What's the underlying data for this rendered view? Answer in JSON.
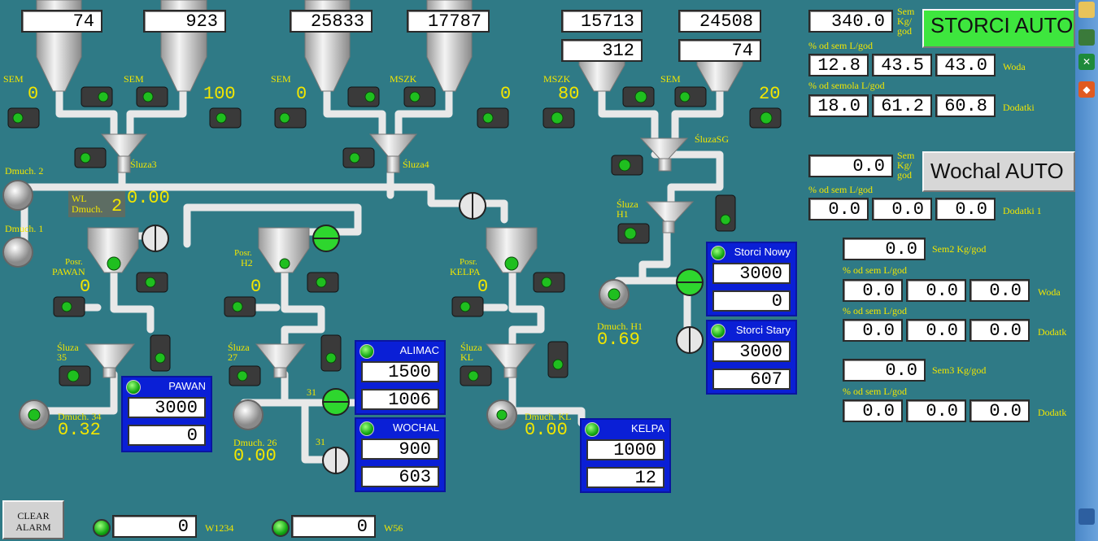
{
  "hoppers_top": {
    "h1": "74",
    "h2": "923",
    "h3": "25833",
    "h4": "17787",
    "h5_top": "15713",
    "h5_sub": "312",
    "h6_top": "24508",
    "h6_sub": "74"
  },
  "motor_labels": {
    "m1_name": "SEM",
    "m1_val": "0",
    "m2_name": "SEM",
    "m2_val": "100",
    "m3_name": "SEM",
    "m3_val": "0",
    "m4_name": "MSZK",
    "m4_val": "0",
    "m5_name": "MSZK",
    "m5_val": "80",
    "m6_name": "SEM",
    "m6_val": "20"
  },
  "sluices": {
    "s3": "Śluza3",
    "s4": "Śluza4",
    "ssg": "ŚluzaSG",
    "sh1_a": "Śluza",
    "sh1_b": "H1",
    "s35_a": "Śluza",
    "s35_b": "35",
    "s27_a": "Śluza",
    "s27_b": "27",
    "skl_a": "Śluza",
    "skl_b": "KL"
  },
  "blowers": {
    "d2": "Dmuch. 2",
    "d1": "Dmuch. 1",
    "wl_a": "WL",
    "wl_b": "Dmuch.",
    "wl_num": "2",
    "wl_val": "0.00",
    "d34": "Dmuch. 34",
    "d34_val": "0.32",
    "d26": "Dmuch. 26",
    "d26_val": "0.00",
    "dkl": "Dmuch. KL",
    "dkl_val": "0.00",
    "dh1": "Dmuch. H1",
    "dh1_val": "0.69"
  },
  "posr": {
    "pawan_a": "Posr.",
    "pawan_b": "PAWAN",
    "pawan_val": "0",
    "h2_a": "Posr.",
    "h2_b": "H2",
    "h2_val": "0",
    "kelpa_a": "Posr.",
    "kelpa_b": "KELPA",
    "kelpa_val": "0"
  },
  "small_labels": {
    "v31a": "31",
    "v31b": "31"
  },
  "panels": {
    "pawan": {
      "title": "PAWAN",
      "v1": "3000",
      "v2": "0"
    },
    "alimac": {
      "title": "ALIMAC",
      "v1": "1500",
      "v2": "1006"
    },
    "wochal": {
      "title": "WOCHAL",
      "v1": "900",
      "v2": "603"
    },
    "kelpa": {
      "title": "KELPA",
      "v1": "1000",
      "v2": "12"
    },
    "storci_nowy": {
      "title": "Storci Nowy",
      "v1": "3000",
      "v2": "0"
    },
    "storci_stary": {
      "title": "Storci Stary",
      "v1": "3000",
      "v2": "607"
    }
  },
  "right_storci": {
    "sem_val": "340.0",
    "sem_unit_a": "Sem",
    "sem_unit_b": "Kg/",
    "sem_unit_c": "god",
    "button": "STORCI AUTO",
    "hdr1": "% od sem L/god",
    "w1": "12.8",
    "w2": "43.5",
    "w3": "43.0",
    "woda": "Woda",
    "hdr2": "% od semola    L/god",
    "d1": "18.0",
    "d2": "61.2",
    "d3": "60.8",
    "dodatki": "Dodatki"
  },
  "right_wochal": {
    "sem_val": "0.0",
    "sem_unit_a": "Sem",
    "sem_unit_b": "Kg/",
    "sem_unit_c": "god",
    "button": "Wochal AUTO",
    "hdr1": "% od sem L/god",
    "a1": "0.0",
    "a2": "0.0",
    "a3": "0.0",
    "dodatki1": "Dodatki 1"
  },
  "right_sem2": {
    "val": "0.0",
    "label": "Sem2 Kg/god",
    "hdr1": "% od sem L/god",
    "w1": "0.0",
    "w2": "0.0",
    "w3": "0.0",
    "woda": "Woda",
    "hdr2": "% od sem L/god",
    "d1": "0.0",
    "d2": "0.0",
    "d3": "0.0",
    "dodatki": "Dodatk"
  },
  "right_sem3": {
    "val": "0.0",
    "label": "Sem3 Kg/god",
    "hdr1": "% od sem L/god",
    "d1": "0.0",
    "d2": "0.0",
    "d3": "0.0",
    "dodatki": "Dodatk"
  },
  "bottom": {
    "clear_a": "CLEAR",
    "clear_b": "ALARM",
    "w1234_val": "0",
    "w1234": "W1234",
    "w56_val": "0",
    "w56": "W56"
  },
  "colors": {
    "background": "#2f7a86",
    "label_yellow": "#f2e600",
    "panel_blue": "#0a1fd6",
    "ok_green": "#12a812"
  }
}
